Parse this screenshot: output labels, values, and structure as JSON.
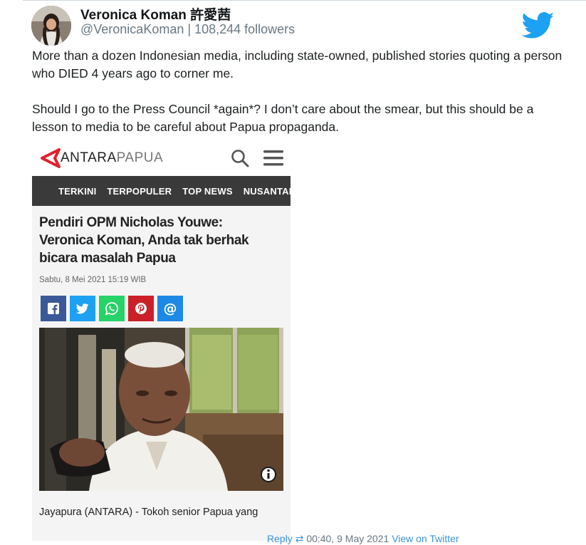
{
  "author": {
    "name": "Veronica Koman 許愛茜",
    "handle": "@VeronicaKoman",
    "separator": "|",
    "followers": "108,244 followers"
  },
  "tweet": {
    "paragraphs": [
      "More than a dozen Indonesian media, including state-owned, published stories quoting a person who DIED 4 years ago to corner me.",
      "Should I go to the Press Council *again*? I don’t care about the smear, but this should be a lesson to media to be careful about Papua propaganda."
    ]
  },
  "embed": {
    "logo_main": "ANTARA",
    "logo_sub": "PAPUA",
    "nav_items": [
      "TERKINI",
      "TERPOPULER",
      "TOP NEWS",
      "NUSANTARA"
    ],
    "headline": "Pendiri OPM Nicholas Youwe: Veronica Koman, Anda tak berhak bicara masalah Papua",
    "date": "Sabtu, 8 Mei 2021 15:19 WIB",
    "caption": "Jayapura (ANTARA) - Tokoh senior Papua yang",
    "share_colors": {
      "facebook": "#3b5998",
      "twitter": "#1da1f2",
      "whatsapp": "#25d366",
      "pinterest": "#cb2027",
      "email": "#1e88e5"
    },
    "logo_color": "#e0202e",
    "nav_bg": "#3a3a3a"
  },
  "footer": {
    "reply": "Reply",
    "time": "00:40, 9 May 2021",
    "view": "View on Twitter"
  }
}
